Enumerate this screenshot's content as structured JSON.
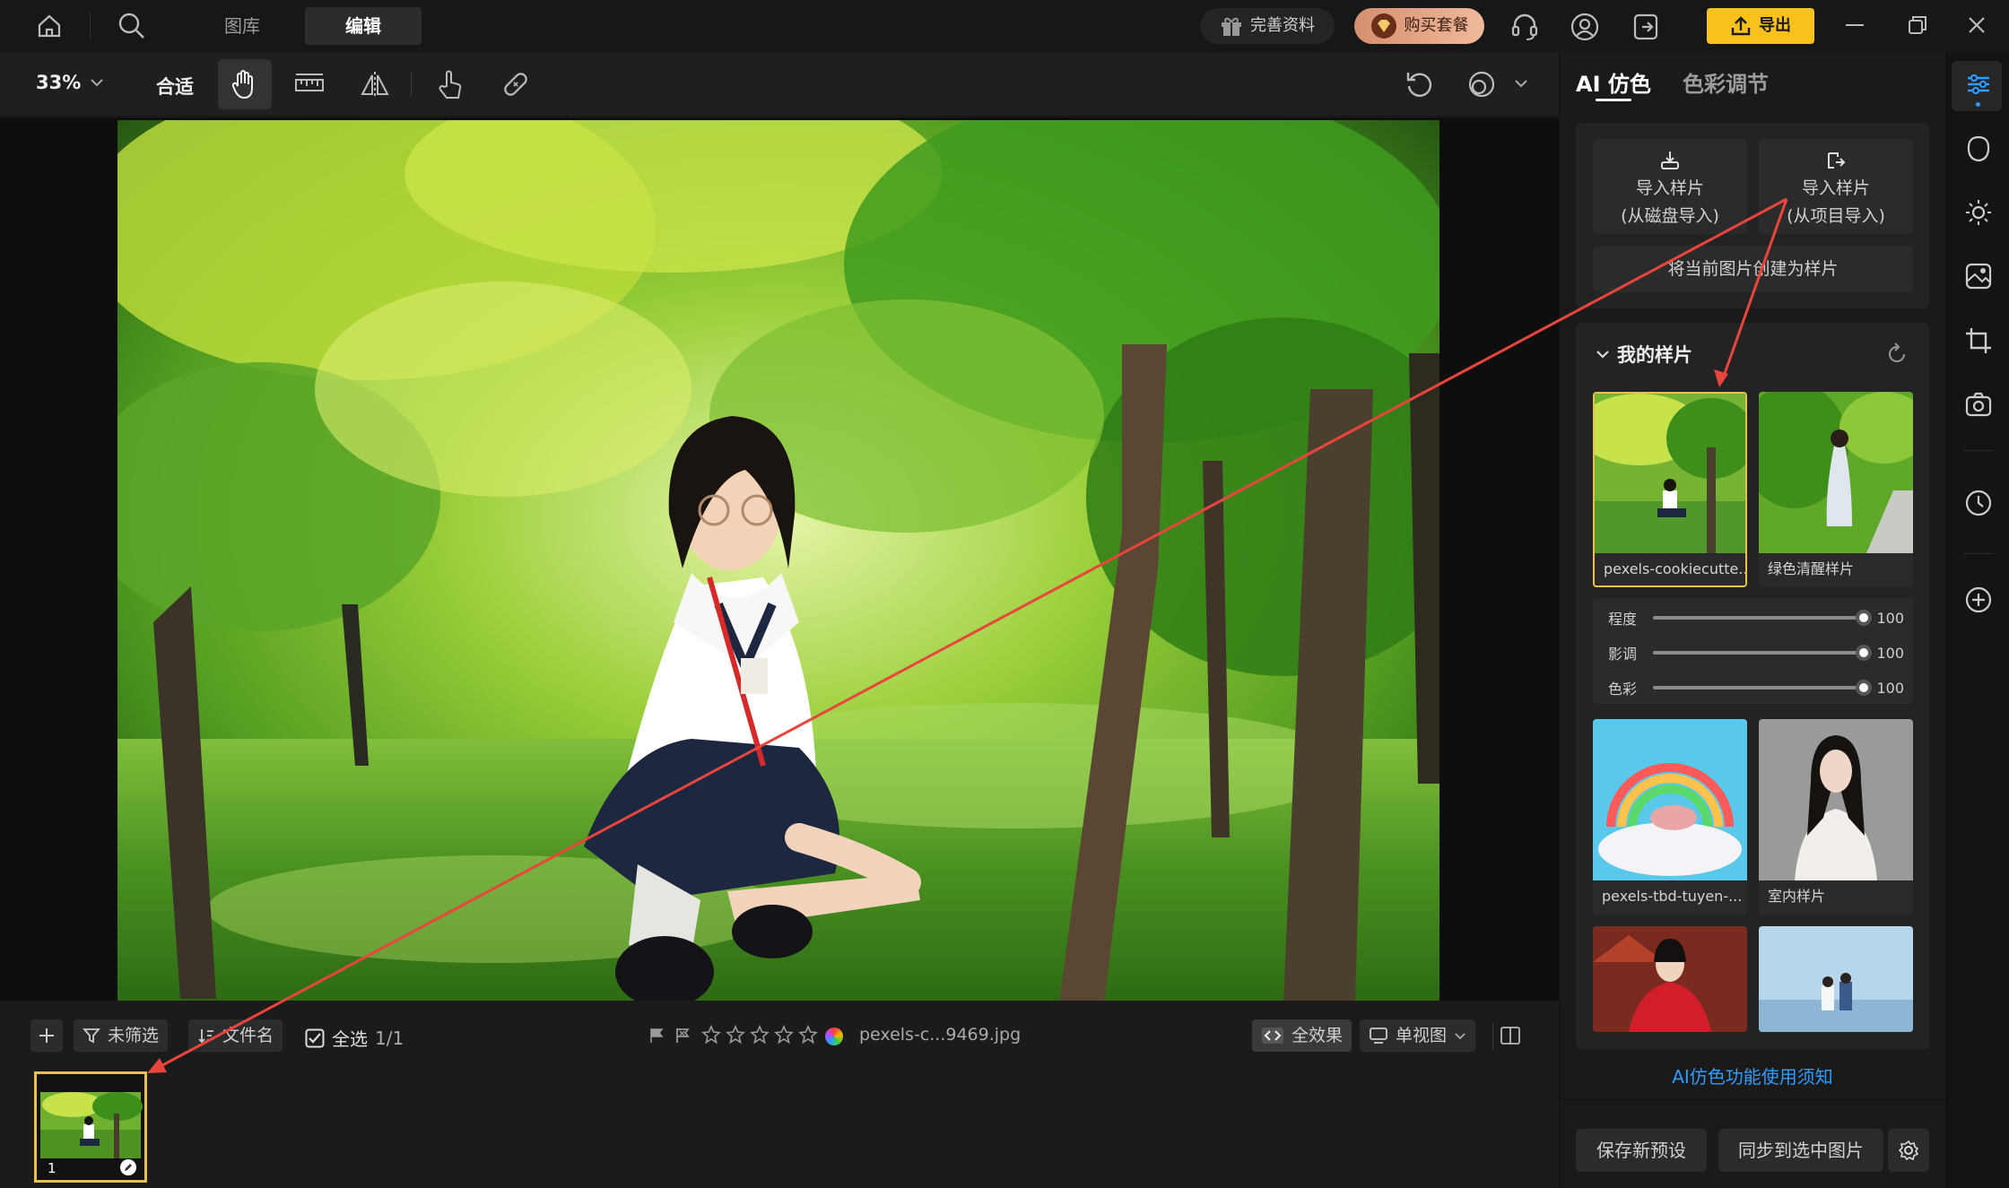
{
  "topbar": {
    "tabs": [
      "图库",
      "编辑"
    ],
    "complete_profile": "完善资料",
    "buy_package": "购买套餐",
    "export": "导出"
  },
  "toolbar": {
    "zoom": "33%",
    "fit": "合适"
  },
  "filmstrip_bar": {
    "filter": "未筛选",
    "sort": "文件名",
    "select_all": "全选",
    "count": "1/1",
    "filename": "pexels-c...9469.jpg",
    "all_effects": "全效果",
    "single_view": "单视图",
    "rating": 0
  },
  "filmstrip": {
    "items": [
      {
        "index": "1"
      }
    ]
  },
  "panel": {
    "tabs": [
      "AI 仿色",
      "色彩调节"
    ],
    "import_disk": [
      "导入样片",
      "(从磁盘导入)"
    ],
    "import_project": [
      "导入样片",
      "(从项目导入)"
    ],
    "create_sample": "将当前图片创建为样片",
    "my_samples": "我的样片",
    "samples": [
      {
        "caption": "pexels-cookiecutte..."
      },
      {
        "caption": "绿色清醒样片"
      },
      {
        "caption": "pexels-tbd-tuyen-..."
      },
      {
        "caption": "室内样片"
      }
    ],
    "sliders": [
      {
        "label": "程度",
        "value": "100"
      },
      {
        "label": "影调",
        "value": "100"
      },
      {
        "label": "色彩",
        "value": "100"
      }
    ],
    "notice_link": "AI仿色功能使用须知",
    "save_preset": "保存新预设",
    "sync": "同步到选中图片"
  },
  "colors": {
    "accent_blue": "#2f9cff",
    "export_yellow": "#f7c21b",
    "selection_gold": "#e8c04a",
    "annotation_red": "#e8453c"
  }
}
